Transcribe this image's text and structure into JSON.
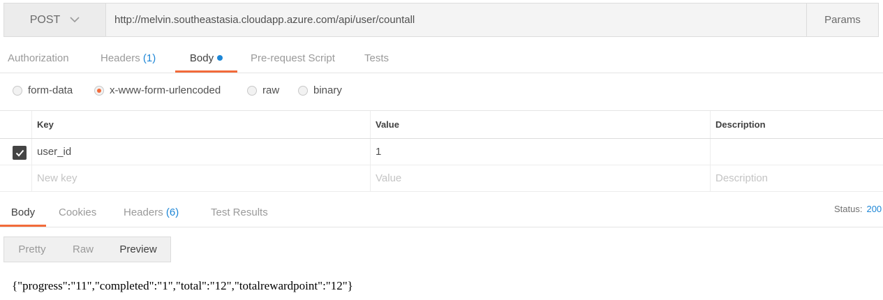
{
  "request": {
    "method": "POST",
    "url": "http://melvin.southeastasia.cloudapp.azure.com/api/user/countall",
    "params_label": "Params"
  },
  "request_tabs": {
    "authorization": "Authorization",
    "headers": "Headers",
    "headers_count": "(1)",
    "body": "Body",
    "prerequest": "Pre-request Script",
    "tests": "Tests"
  },
  "body_types": {
    "form_data": "form-data",
    "urlencoded": "x-www-form-urlencoded",
    "raw": "raw",
    "binary": "binary",
    "selected": "x-www-form-urlencoded"
  },
  "kv_table": {
    "headers": {
      "key": "Key",
      "value": "Value",
      "description": "Description"
    },
    "rows": [
      {
        "checked": true,
        "key": "user_id",
        "value": "1",
        "description": ""
      }
    ],
    "placeholders": {
      "key": "New key",
      "value": "Value",
      "description": "Description"
    }
  },
  "response_tabs": {
    "body": "Body",
    "cookies": "Cookies",
    "headers": "Headers",
    "headers_count": "(6)",
    "test_results": "Test Results"
  },
  "status": {
    "label": "Status:",
    "code": "200"
  },
  "view_modes": {
    "pretty": "Pretty",
    "raw": "Raw",
    "preview": "Preview",
    "selected": "Preview"
  },
  "response_body": "{\"progress\":\"11\",\"completed\":\"1\",\"total\":\"12\",\"totalrewardpoint\":\"12\"}",
  "colors": {
    "accent": "#f26b3a",
    "link": "#1d86d6",
    "checkbox": "#444444"
  }
}
